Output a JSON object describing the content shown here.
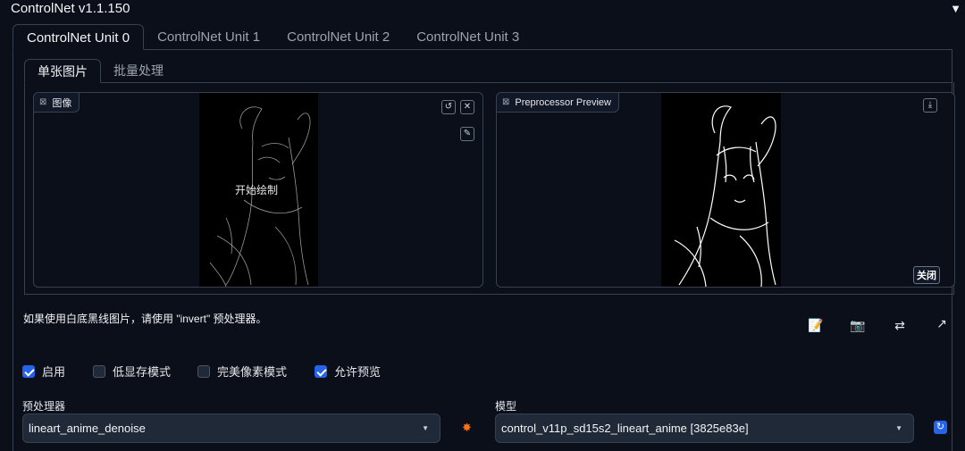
{
  "header": {
    "title": "ControlNet v1.1.150",
    "collapse_glyph": "▼"
  },
  "unit_tabs": [
    "ControlNet Unit 0",
    "ControlNet Unit 1",
    "ControlNet Unit 2",
    "ControlNet Unit 3"
  ],
  "mode_tabs": [
    "单张图片",
    "批量处理"
  ],
  "image_panel": {
    "label": "图像",
    "overlay_text": "开始绘制",
    "icons": [
      "image-icon",
      "undo-icon",
      "close-icon",
      "brush-icon"
    ]
  },
  "preview_panel": {
    "label": "Preprocessor Preview",
    "close_label": "关闭",
    "icons": [
      "image-icon",
      "download-icon"
    ]
  },
  "note": "如果使用白底黑线图片，请使用 \"invert\" 预处理器。",
  "toolbar_icons": [
    "new-canvas-icon",
    "camera-icon",
    "swap-icon",
    "send-dimensions-icon"
  ],
  "checkboxes": [
    {
      "label": "启用",
      "checked": true
    },
    {
      "label": "低显存模式",
      "checked": false
    },
    {
      "label": "完美像素模式",
      "checked": false
    },
    {
      "label": "允许预览",
      "checked": true
    }
  ],
  "preprocessor": {
    "label": "预处理器",
    "value": "lineart_anime_denoise"
  },
  "model": {
    "label": "模型",
    "value": "control_v11p_sd15s2_lineart_anime [3825e83e]"
  },
  "colors": {
    "background": "#0b0f19",
    "accent": "#2563eb",
    "border": "#374151"
  }
}
